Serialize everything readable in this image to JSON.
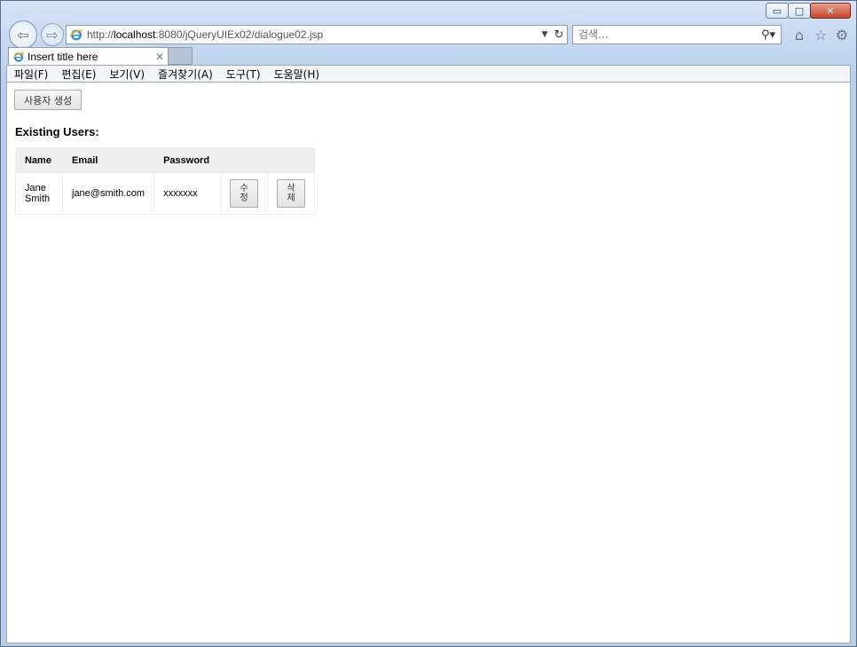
{
  "browser": {
    "url_prefix": "http://",
    "url_host": "localhost",
    "url_rest": ":8080/jQueryUIEx02/dialogue02.jsp",
    "search_placeholder": "검색...",
    "tab_title": "Insert title here",
    "menu": [
      "파일(F)",
      "편집(E)",
      "보기(V)",
      "즐겨찾기(A)",
      "도구(T)",
      "도움말(H)"
    ]
  },
  "page": {
    "create_button": "사용자 생성",
    "heading": "Existing Users:",
    "columns": [
      "Name",
      "Email",
      "Password",
      "",
      ""
    ],
    "rows": [
      {
        "name": "Jane Smith",
        "email": "jane@smith.com",
        "password": "xxxxxxx",
        "edit": "수정",
        "delete": "삭제"
      }
    ]
  }
}
